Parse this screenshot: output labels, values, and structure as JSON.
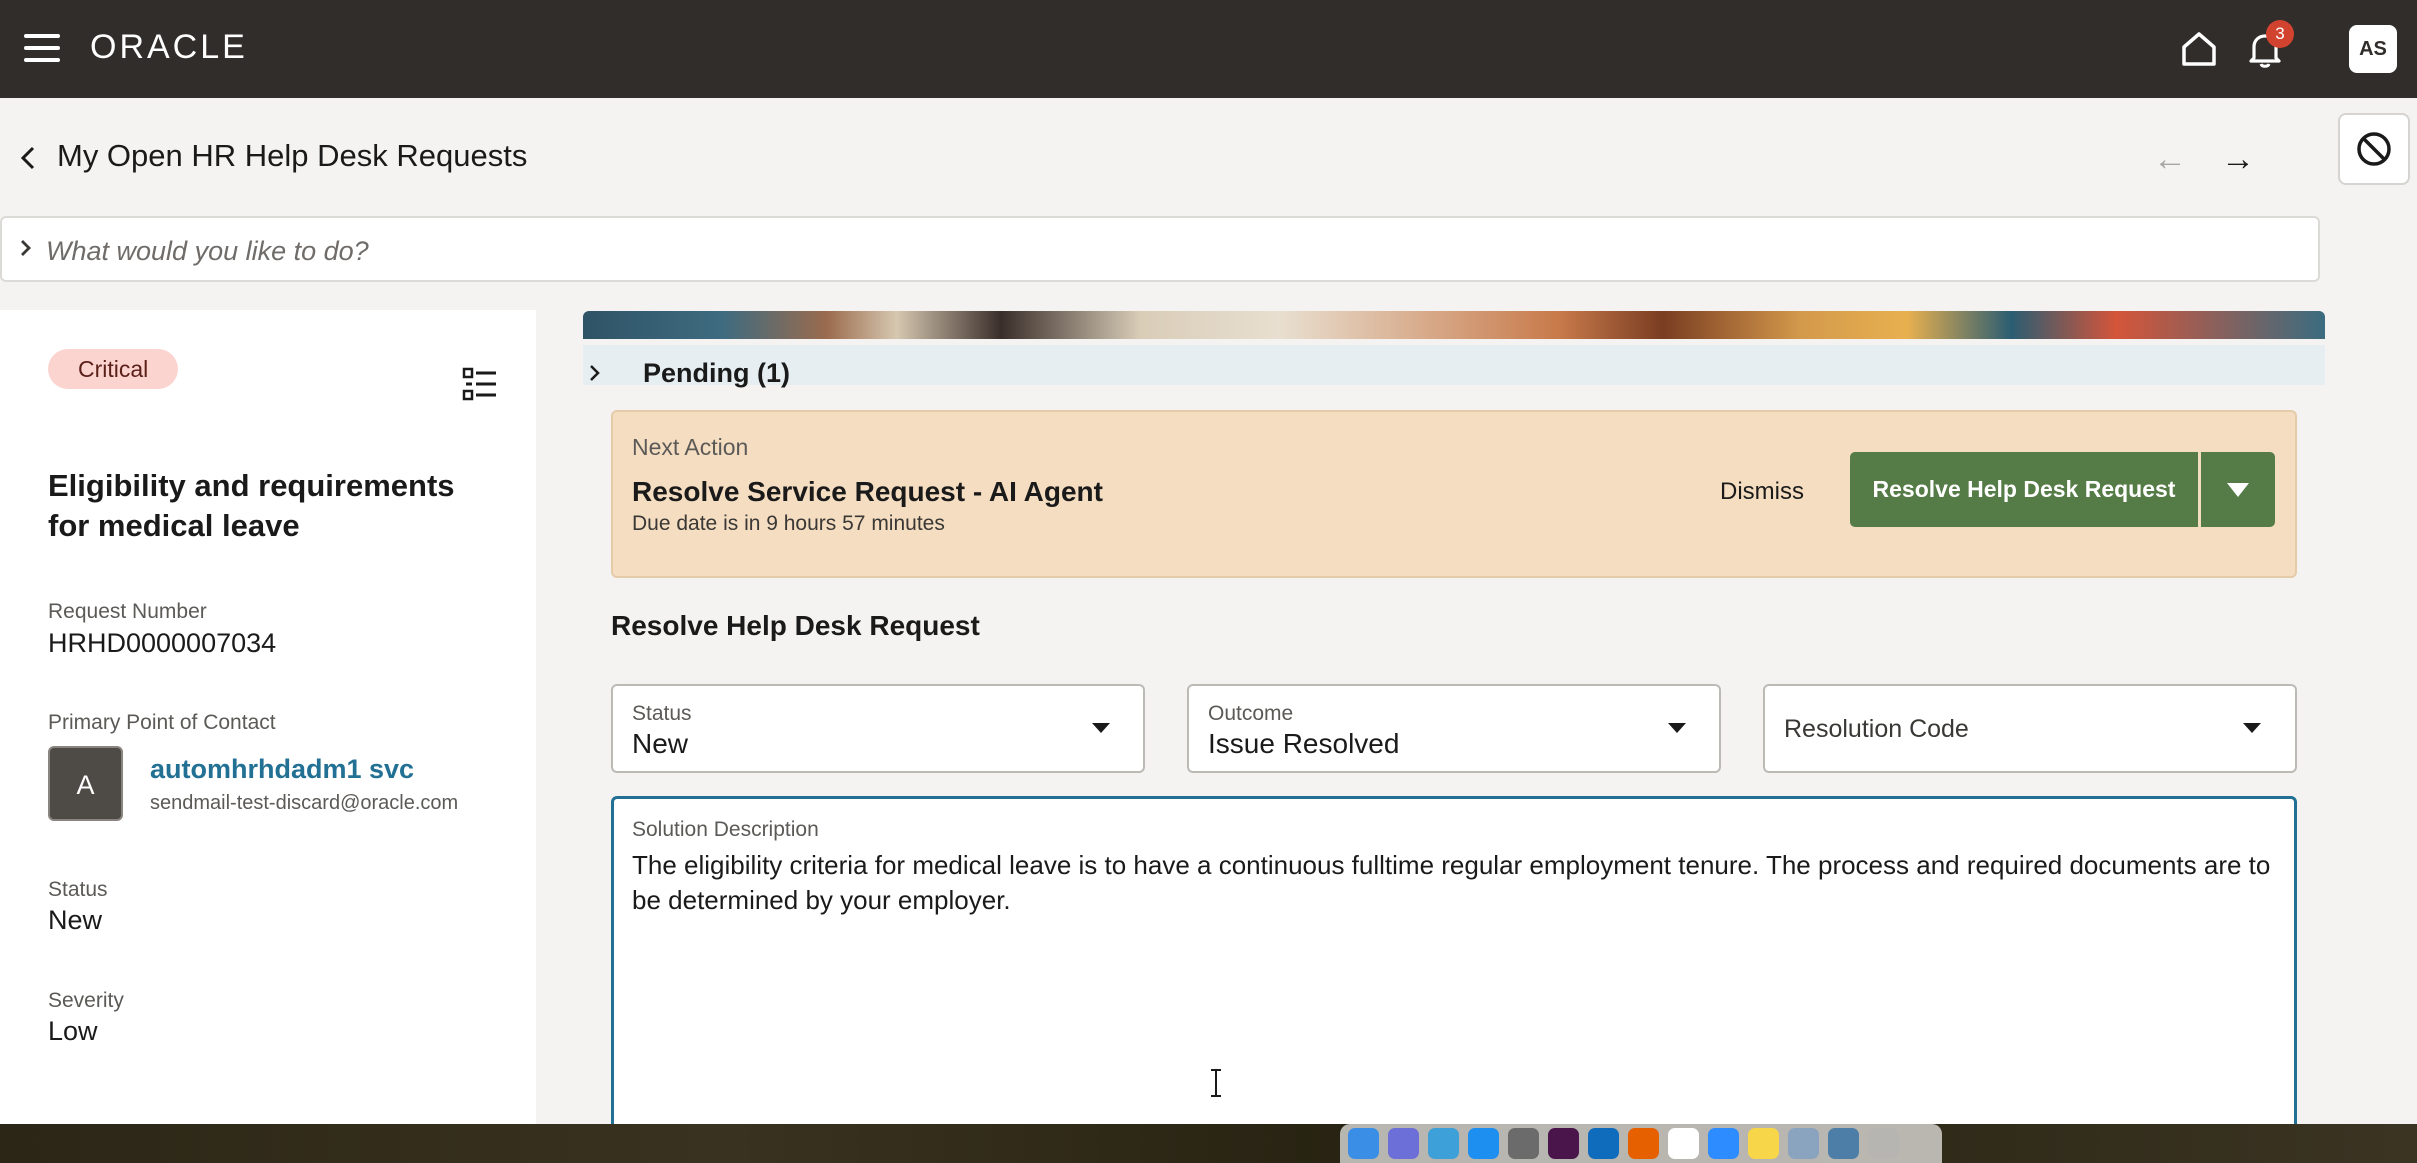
{
  "topbar": {
    "logo_text": "ORACLE",
    "notification_count": "3",
    "user_initials": "AS",
    "icons": [
      "menu-icon",
      "home-icon",
      "bell-icon"
    ]
  },
  "header": {
    "page_title": "My Open HR Help Desk Requests",
    "prev_arrow": "←",
    "next_arrow": "→"
  },
  "search": {
    "placeholder": "What would you like to do?"
  },
  "request": {
    "priority_badge": "Critical",
    "title": "Eligibility and requirements for medical leave",
    "request_number_label": "Request Number",
    "request_number": "HRHD0000007034",
    "contact_label": "Primary Point of Contact",
    "contact_initial": "A",
    "contact_name": "automhrhdadm1 svc",
    "contact_email": "sendmail-test-discard@oracle.com",
    "status_label": "Status",
    "status": "New",
    "severity_label": "Severity",
    "severity": "Low"
  },
  "pending": {
    "label": "Pending (1)"
  },
  "next_action": {
    "label": "Next Action",
    "title": "Resolve Service Request - AI Agent",
    "due": "Due date is in 9 hours 57 minutes",
    "dismiss_label": "Dismiss",
    "primary_button_label": "Resolve Help Desk Request"
  },
  "resolve_form": {
    "section_title": "Resolve Help Desk Request",
    "status_label": "Status",
    "status_value": "New",
    "outcome_label": "Outcome",
    "outcome_value": "Issue Resolved",
    "resolution_code_placeholder": "Resolution Code",
    "solution_label": "Solution Description",
    "solution_text": " The eligibility criteria for medical leave is to have a continuous fulltime regular employment tenure. The process and required documents are to be determined by your employer."
  },
  "colors": {
    "topbar": "#312d2a",
    "critical_badge_bg": "#fbd4d0",
    "next_action_bg": "#f5ddc1",
    "primary_button": "#557b47",
    "link": "#227093"
  }
}
